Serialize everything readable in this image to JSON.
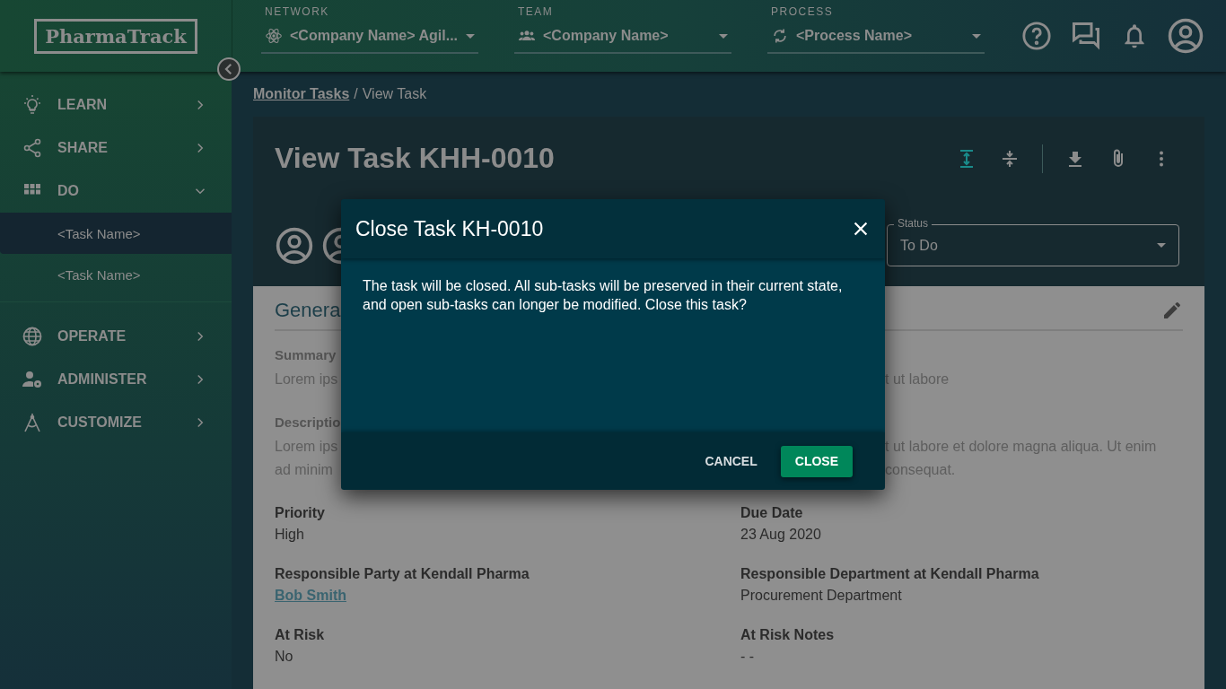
{
  "app": {
    "logo": "PharmaTrack"
  },
  "top_bar": {
    "selectors": [
      {
        "label": "NETWORK",
        "value": "<Company Name> Agil..."
      },
      {
        "label": "TEAM",
        "value": "<Company Name>"
      },
      {
        "label": "PROCESS",
        "value": "<Process Name>"
      }
    ]
  },
  "sidebar": {
    "items": [
      {
        "label": "LEARN",
        "expanded": false
      },
      {
        "label": "SHARE",
        "expanded": false
      },
      {
        "label": "DO",
        "expanded": true,
        "children": [
          {
            "label": "<Task Name>",
            "selected": true
          },
          {
            "label": "<Task Name>",
            "selected": false
          }
        ]
      },
      {
        "label": "OPERATE",
        "expanded": false
      },
      {
        "label": "ADMINISTER",
        "expanded": false
      },
      {
        "label": "CUSTOMIZE",
        "expanded": false
      }
    ]
  },
  "breadcrumb": {
    "link": "Monitor Tasks",
    "separator": "/",
    "current": "View Task"
  },
  "task": {
    "title": "View Task KHH-0010",
    "status": {
      "label": "Status",
      "value": "To Do"
    },
    "section_title": "Genera",
    "partial_fields": [
      {
        "label": "Summary",
        "lines": [
          {
            "left": "Lorem ips",
            "right": "t ut labore"
          }
        ]
      },
      {
        "label": "Descriptio",
        "lines": [
          {
            "left": "Lorem ips",
            "right": "t ut labore et dolore magna aliqua. Ut enim"
          },
          {
            "left": "ad minim",
            "right": "consequat."
          }
        ]
      }
    ],
    "fields": [
      {
        "label": "Priority",
        "value": "High",
        "kind": "text"
      },
      {
        "label": "Due Date",
        "value": "23 Aug 2020",
        "kind": "text"
      },
      {
        "label": "Responsible Party at Kendall Pharma",
        "value": "Bob Smith",
        "kind": "link"
      },
      {
        "label": "Responsible Department at Kendall Pharma",
        "value": "Procurement Department",
        "kind": "text"
      },
      {
        "label": "At Risk",
        "value": "No",
        "kind": "text"
      },
      {
        "label": "At Risk Notes",
        "value": "- -",
        "kind": "text"
      }
    ]
  },
  "dialog": {
    "title": "Close Task KH-0010",
    "message": "The task will be closed. All sub-tasks will be preserved in their current state, and open sub-tasks can longer be modified. Close this task?",
    "buttons": [
      {
        "label": "CANCEL",
        "kind": "text"
      },
      {
        "label": "CLOSE",
        "kind": "primary"
      }
    ]
  }
}
